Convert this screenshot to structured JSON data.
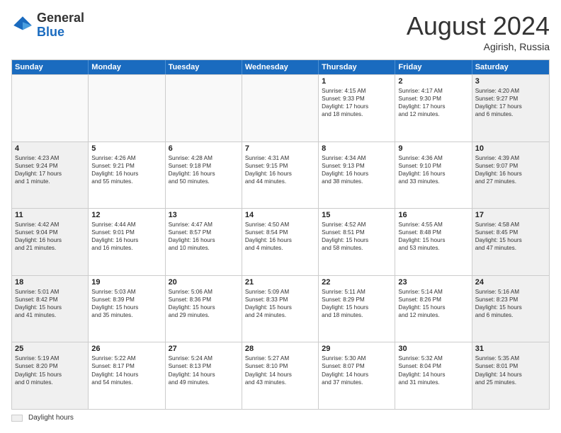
{
  "header": {
    "logo_general": "General",
    "logo_blue": "Blue",
    "month_year": "August 2024",
    "location": "Agirish, Russia"
  },
  "days_of_week": [
    "Sunday",
    "Monday",
    "Tuesday",
    "Wednesday",
    "Thursday",
    "Friday",
    "Saturday"
  ],
  "weeks": [
    [
      {
        "day": "",
        "lines": []
      },
      {
        "day": "",
        "lines": []
      },
      {
        "day": "",
        "lines": []
      },
      {
        "day": "",
        "lines": []
      },
      {
        "day": "1",
        "lines": [
          "Sunrise: 4:15 AM",
          "Sunset: 9:33 PM",
          "Daylight: 17 hours",
          "and 18 minutes."
        ]
      },
      {
        "day": "2",
        "lines": [
          "Sunrise: 4:17 AM",
          "Sunset: 9:30 PM",
          "Daylight: 17 hours",
          "and 12 minutes."
        ]
      },
      {
        "day": "3",
        "lines": [
          "Sunrise: 4:20 AM",
          "Sunset: 9:27 PM",
          "Daylight: 17 hours",
          "and 6 minutes."
        ]
      }
    ],
    [
      {
        "day": "4",
        "lines": [
          "Sunrise: 4:23 AM",
          "Sunset: 9:24 PM",
          "Daylight: 17 hours",
          "and 1 minute."
        ]
      },
      {
        "day": "5",
        "lines": [
          "Sunrise: 4:26 AM",
          "Sunset: 9:21 PM",
          "Daylight: 16 hours",
          "and 55 minutes."
        ]
      },
      {
        "day": "6",
        "lines": [
          "Sunrise: 4:28 AM",
          "Sunset: 9:18 PM",
          "Daylight: 16 hours",
          "and 50 minutes."
        ]
      },
      {
        "day": "7",
        "lines": [
          "Sunrise: 4:31 AM",
          "Sunset: 9:15 PM",
          "Daylight: 16 hours",
          "and 44 minutes."
        ]
      },
      {
        "day": "8",
        "lines": [
          "Sunrise: 4:34 AM",
          "Sunset: 9:13 PM",
          "Daylight: 16 hours",
          "and 38 minutes."
        ]
      },
      {
        "day": "9",
        "lines": [
          "Sunrise: 4:36 AM",
          "Sunset: 9:10 PM",
          "Daylight: 16 hours",
          "and 33 minutes."
        ]
      },
      {
        "day": "10",
        "lines": [
          "Sunrise: 4:39 AM",
          "Sunset: 9:07 PM",
          "Daylight: 16 hours",
          "and 27 minutes."
        ]
      }
    ],
    [
      {
        "day": "11",
        "lines": [
          "Sunrise: 4:42 AM",
          "Sunset: 9:04 PM",
          "Daylight: 16 hours",
          "and 21 minutes."
        ]
      },
      {
        "day": "12",
        "lines": [
          "Sunrise: 4:44 AM",
          "Sunset: 9:01 PM",
          "Daylight: 16 hours",
          "and 16 minutes."
        ]
      },
      {
        "day": "13",
        "lines": [
          "Sunrise: 4:47 AM",
          "Sunset: 8:57 PM",
          "Daylight: 16 hours",
          "and 10 minutes."
        ]
      },
      {
        "day": "14",
        "lines": [
          "Sunrise: 4:50 AM",
          "Sunset: 8:54 PM",
          "Daylight: 16 hours",
          "and 4 minutes."
        ]
      },
      {
        "day": "15",
        "lines": [
          "Sunrise: 4:52 AM",
          "Sunset: 8:51 PM",
          "Daylight: 15 hours",
          "and 58 minutes."
        ]
      },
      {
        "day": "16",
        "lines": [
          "Sunrise: 4:55 AM",
          "Sunset: 8:48 PM",
          "Daylight: 15 hours",
          "and 53 minutes."
        ]
      },
      {
        "day": "17",
        "lines": [
          "Sunrise: 4:58 AM",
          "Sunset: 8:45 PM",
          "Daylight: 15 hours",
          "and 47 minutes."
        ]
      }
    ],
    [
      {
        "day": "18",
        "lines": [
          "Sunrise: 5:01 AM",
          "Sunset: 8:42 PM",
          "Daylight: 15 hours",
          "and 41 minutes."
        ]
      },
      {
        "day": "19",
        "lines": [
          "Sunrise: 5:03 AM",
          "Sunset: 8:39 PM",
          "Daylight: 15 hours",
          "and 35 minutes."
        ]
      },
      {
        "day": "20",
        "lines": [
          "Sunrise: 5:06 AM",
          "Sunset: 8:36 PM",
          "Daylight: 15 hours",
          "and 29 minutes."
        ]
      },
      {
        "day": "21",
        "lines": [
          "Sunrise: 5:09 AM",
          "Sunset: 8:33 PM",
          "Daylight: 15 hours",
          "and 24 minutes."
        ]
      },
      {
        "day": "22",
        "lines": [
          "Sunrise: 5:11 AM",
          "Sunset: 8:29 PM",
          "Daylight: 15 hours",
          "and 18 minutes."
        ]
      },
      {
        "day": "23",
        "lines": [
          "Sunrise: 5:14 AM",
          "Sunset: 8:26 PM",
          "Daylight: 15 hours",
          "and 12 minutes."
        ]
      },
      {
        "day": "24",
        "lines": [
          "Sunrise: 5:16 AM",
          "Sunset: 8:23 PM",
          "Daylight: 15 hours",
          "and 6 minutes."
        ]
      }
    ],
    [
      {
        "day": "25",
        "lines": [
          "Sunrise: 5:19 AM",
          "Sunset: 8:20 PM",
          "Daylight: 15 hours",
          "and 0 minutes."
        ]
      },
      {
        "day": "26",
        "lines": [
          "Sunrise: 5:22 AM",
          "Sunset: 8:17 PM",
          "Daylight: 14 hours",
          "and 54 minutes."
        ]
      },
      {
        "day": "27",
        "lines": [
          "Sunrise: 5:24 AM",
          "Sunset: 8:13 PM",
          "Daylight: 14 hours",
          "and 49 minutes."
        ]
      },
      {
        "day": "28",
        "lines": [
          "Sunrise: 5:27 AM",
          "Sunset: 8:10 PM",
          "Daylight: 14 hours",
          "and 43 minutes."
        ]
      },
      {
        "day": "29",
        "lines": [
          "Sunrise: 5:30 AM",
          "Sunset: 8:07 PM",
          "Daylight: 14 hours",
          "and 37 minutes."
        ]
      },
      {
        "day": "30",
        "lines": [
          "Sunrise: 5:32 AM",
          "Sunset: 8:04 PM",
          "Daylight: 14 hours",
          "and 31 minutes."
        ]
      },
      {
        "day": "31",
        "lines": [
          "Sunrise: 5:35 AM",
          "Sunset: 8:01 PM",
          "Daylight: 14 hours",
          "and 25 minutes."
        ]
      }
    ]
  ],
  "footer": {
    "legend_label": "Daylight hours"
  }
}
